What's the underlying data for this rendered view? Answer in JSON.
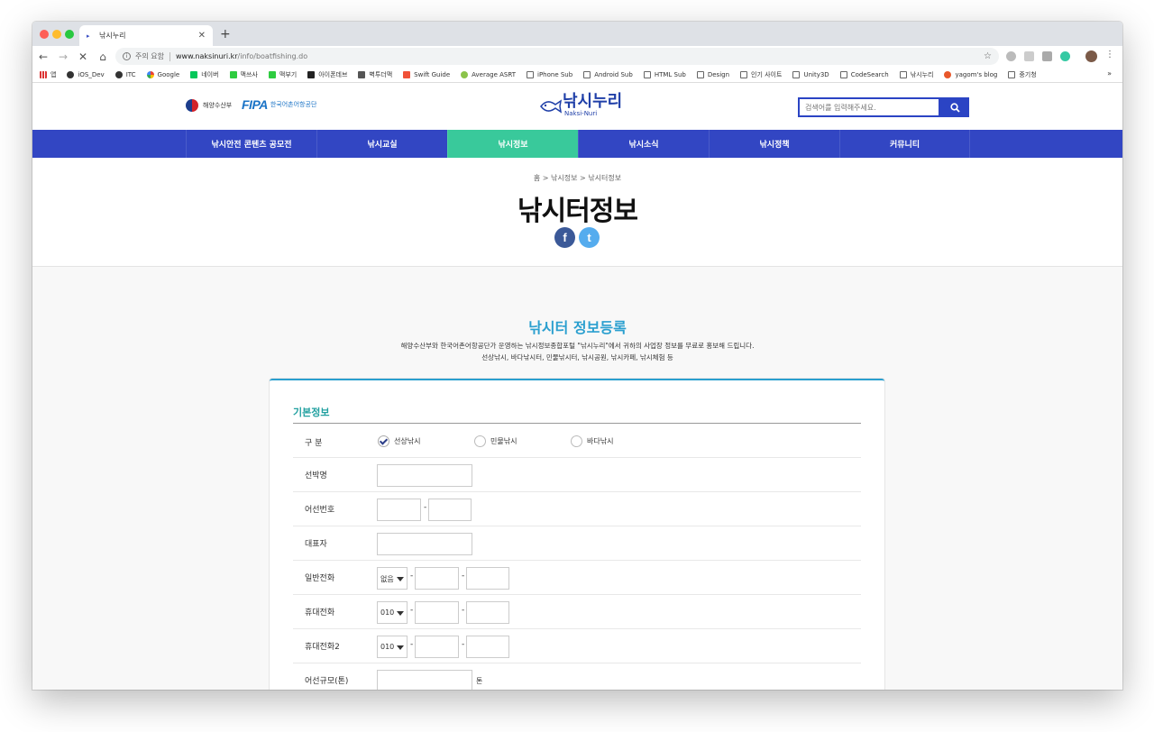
{
  "browser": {
    "tab_title": "낚시누리",
    "new_tab": "+",
    "security_label": "주의 요함",
    "url_host": "www.naksinuri.kr",
    "url_path": "/info/boatfishing.do",
    "bookmarks": [
      "앱",
      "iOS_Dev",
      "ITC",
      "Google",
      "네이버",
      "맥쓰사",
      "맥부기",
      "아이폰데브",
      "벽투더맥",
      "Swift Guide",
      "Average ASRT",
      "iPhone Sub",
      "Android Sub",
      "HTML Sub",
      "Design",
      "인기 사이트",
      "Unity3D",
      "CodeSearch",
      "낚시누리",
      "yagom's blog",
      "중기청"
    ],
    "bookmarks_more": "»"
  },
  "header": {
    "gov_name": "해양수산부",
    "fipa_mark": "FIPA",
    "fipa_name": "한국어촌어항공단",
    "logo_text": "낚시누리",
    "logo_sub": "Naksi-Nuri",
    "search_placeholder": "검색어를 입력해주세요."
  },
  "gnb": [
    "낚시안전 콘텐츠 공모전",
    "낚시교실",
    "낚시정보",
    "낚시소식",
    "낚시정책",
    "커뮤니티"
  ],
  "hero": {
    "breadcrumb": "홈 > 낚시정보 > 낚시터정보",
    "title": "낚시터정보",
    "fb": "f",
    "tw": "t"
  },
  "register": {
    "title": "낚시터 정보등록",
    "desc1": "해양수산부와 한국어촌어항공단가 운영하는 낚시정보종합포털 \"낚시누리\"에서 귀하의 사업장 정보를 무료로 홍보해 드립니다.",
    "desc2": "선상낚시, 바다낚시터, 민물낚시터, 낚시공원, 낚시카페, 낚시체험 등"
  },
  "form": {
    "section_title": "기본정보",
    "type_label": "구 분",
    "type_options": [
      "선상낚시",
      "민물낚시",
      "바다낚시"
    ],
    "boat_name_label": "선박명",
    "boat_number_label": "어선번호",
    "owner_label": "대표자",
    "phone_label": "일반전화",
    "phone_prefix": "없음",
    "mobile_label": "휴대전화",
    "mobile_prefix": "010",
    "mobile2_label": "휴대전화2",
    "mobile2_prefix": "010",
    "tonnage_label": "어선규모(톤)",
    "tonnage_unit": "톤",
    "dash": "-"
  }
}
